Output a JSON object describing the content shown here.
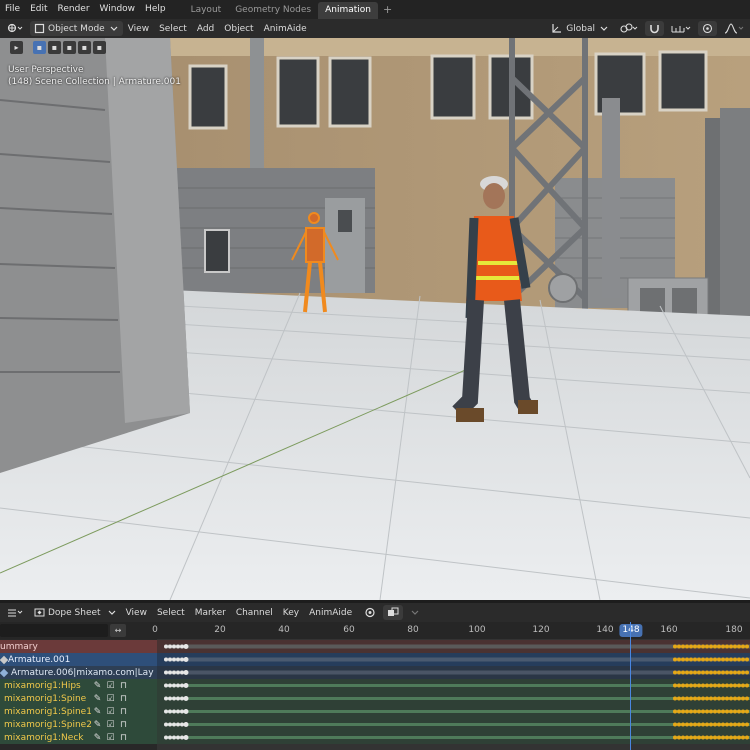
{
  "topbar": {
    "menus": [
      "File",
      "Edit",
      "Render",
      "Window",
      "Help"
    ],
    "tabs": [
      {
        "label": "Layout",
        "active": false
      },
      {
        "label": "Geometry Nodes",
        "active": false
      },
      {
        "label": "Animation",
        "active": true
      }
    ],
    "add_symbol": "+"
  },
  "viewport_header": {
    "mode": "Object Mode",
    "menus": [
      "View",
      "Select",
      "Add",
      "Object",
      "AnimAide"
    ],
    "orientation": "Global"
  },
  "viewport": {
    "perspective": "User Perspective",
    "collection": "(148) Scene Collection | Armature.001"
  },
  "dopesheet_header": {
    "editor": "Dope Sheet",
    "menus": [
      "View",
      "Select",
      "Marker",
      "Channel",
      "Key",
      "AnimAide"
    ]
  },
  "timeline": {
    "frame_labels": [
      "0",
      "20",
      "40",
      "60",
      "80",
      "100",
      "120",
      "140",
      "160",
      "180"
    ],
    "current_frame": "148"
  },
  "channels": [
    {
      "label": "ummary",
      "kind": "summary"
    },
    {
      "label": "Armature.001",
      "kind": "object"
    },
    {
      "label": "Armature.006|mixamo.com|Lay",
      "kind": "action"
    },
    {
      "label": "mixamorig1:Hips",
      "kind": "bone"
    },
    {
      "label": "mixamorig1:Spine",
      "kind": "bone"
    },
    {
      "label": "mixamorig1:Spine1",
      "kind": "bone"
    },
    {
      "label": "mixamorig1:Spine2",
      "kind": "bone"
    },
    {
      "label": "mixamorig1:Neck",
      "kind": "bone"
    }
  ],
  "colors": {
    "accent": "#4772b3",
    "keyframe": "#e6a817",
    "summary_row": "#6b3a3a",
    "object_row": "#2e4f7a",
    "bone_row": "#2e4a3a"
  }
}
